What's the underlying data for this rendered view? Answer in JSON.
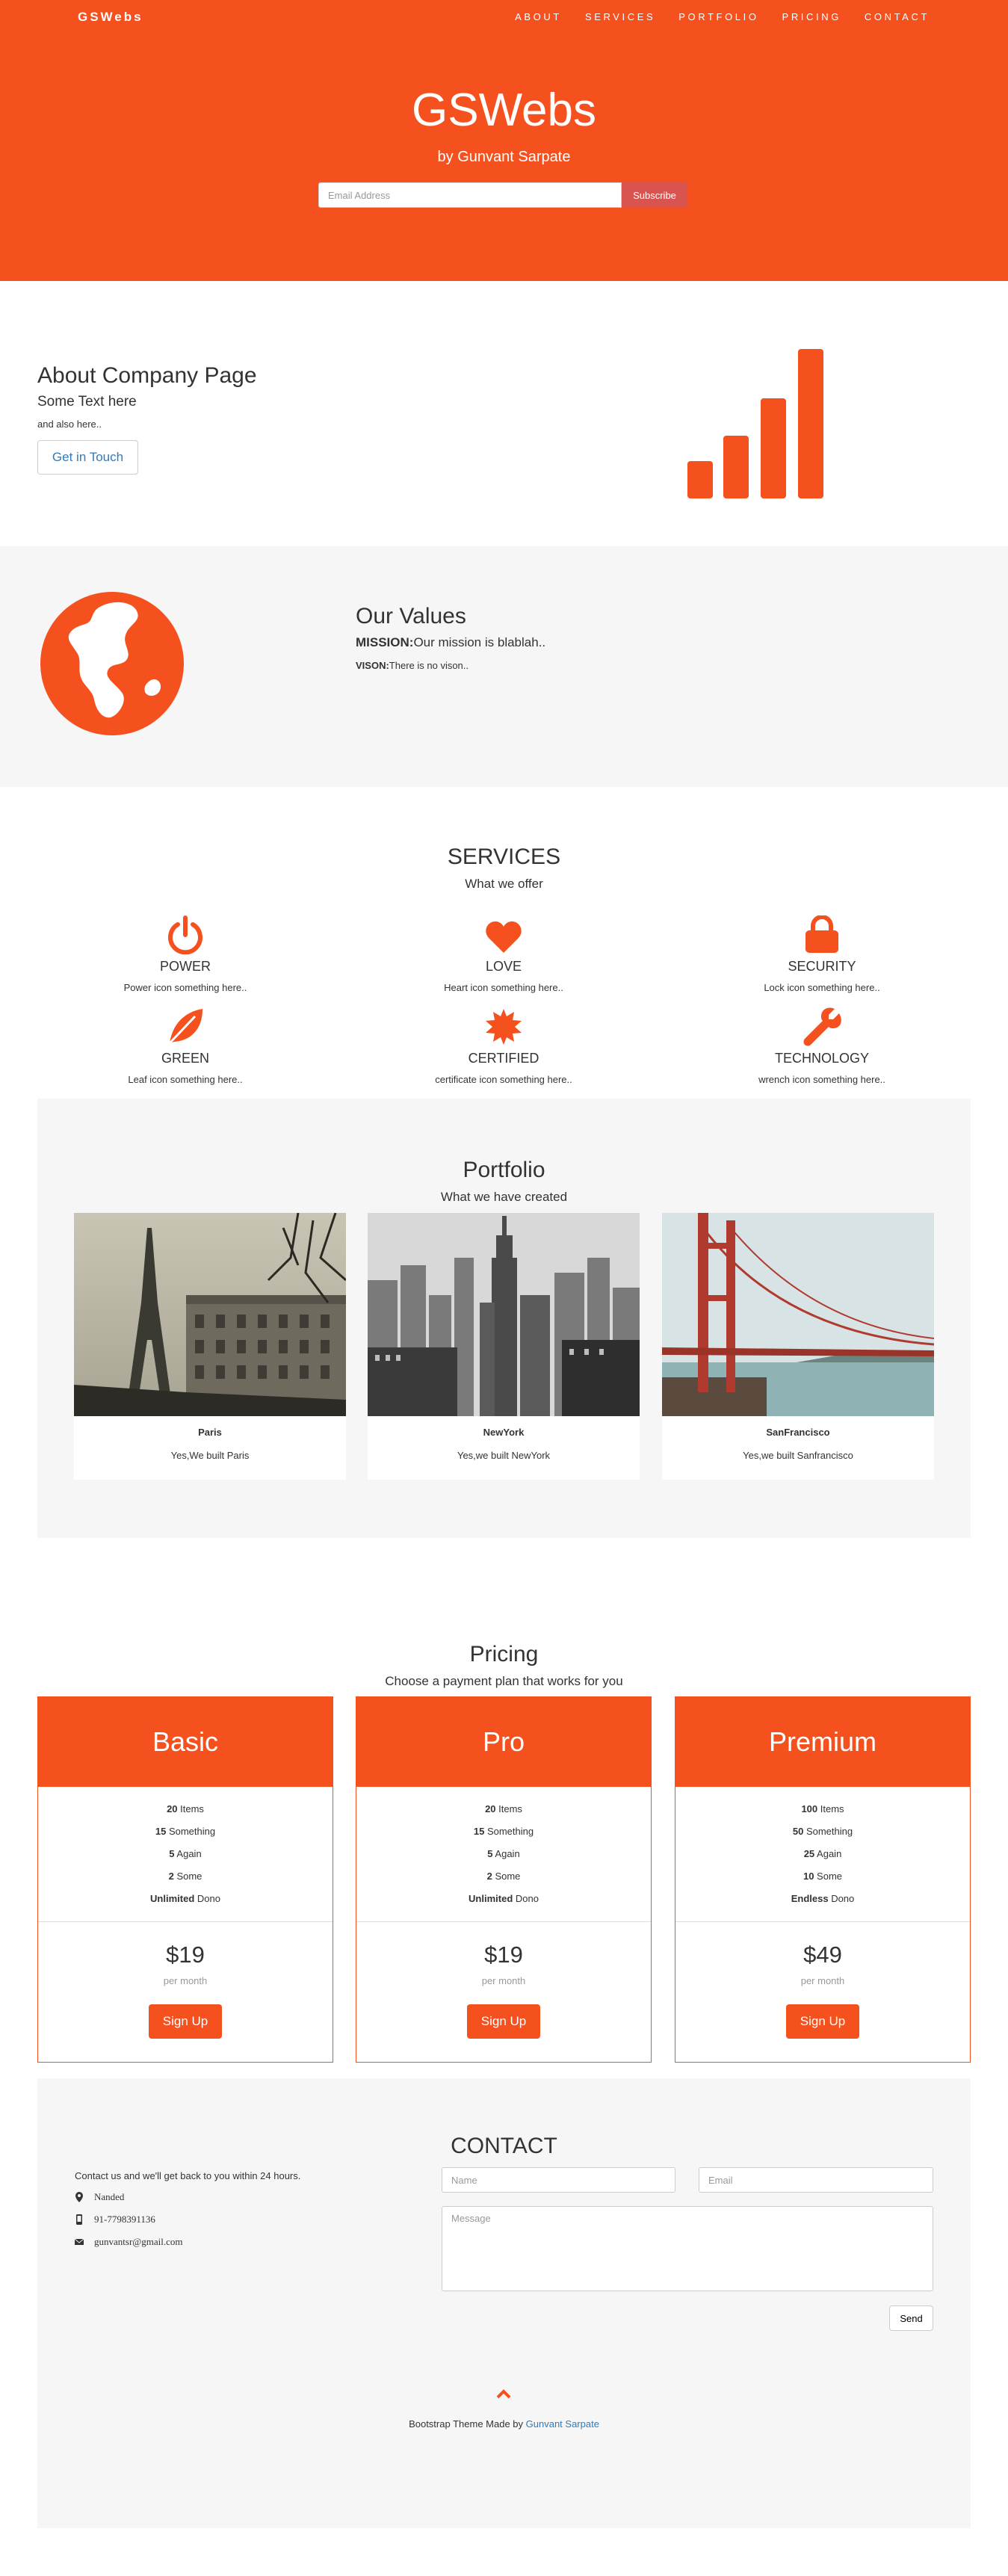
{
  "header": {
    "brand": "GSWebs",
    "nav": [
      "ABOUT",
      "SERVICES",
      "PORTFOLIO",
      "PRICING",
      "CONTACT"
    ],
    "title": "GSWebs",
    "subtitle": "by Gunvant Sarpate",
    "email_placeholder": "Email Address",
    "subscribe_label": "Subscribe"
  },
  "about": {
    "title": "About Company Page",
    "text": "Some Text here",
    "small": "and also here..",
    "button_label": "Get in Touch",
    "icon": "signal-icon"
  },
  "values": {
    "title": "Our Values",
    "mission_label": "MISSION:",
    "mission_text": "Our mission is blablah..",
    "vision_label": "VISON:",
    "vision_text": "There is no vison..",
    "icon": "globe-icon"
  },
  "services": {
    "title": "SERVICES",
    "subtitle": "What we offer",
    "items": [
      {
        "name": "POWER",
        "desc": "Power icon something here..",
        "icon": "power-icon"
      },
      {
        "name": "LOVE",
        "desc": "Heart icon something here..",
        "icon": "heart-icon"
      },
      {
        "name": "SECURITY",
        "desc": "Lock icon something here..",
        "icon": "lock-icon"
      },
      {
        "name": "GREEN",
        "desc": "Leaf icon something here..",
        "icon": "leaf-icon"
      },
      {
        "name": "CERTIFIED",
        "desc": "certificate icon something here..",
        "icon": "certificate-icon"
      },
      {
        "name": "TECHNOLOGY",
        "desc": "wrench icon something here..",
        "icon": "wrench-icon"
      }
    ]
  },
  "portfolio": {
    "title": "Portfolio",
    "subtitle": "What we have created",
    "items": [
      {
        "name": "Paris",
        "desc": "Yes,We built Paris"
      },
      {
        "name": "NewYork",
        "desc": "Yes,we built NewYork"
      },
      {
        "name": "SanFrancisco",
        "desc": "Yes,we built Sanfrancisco"
      }
    ]
  },
  "pricing": {
    "title": "Pricing",
    "subtitle": "Choose a payment plan that works for you",
    "plans": [
      {
        "name": "Basic",
        "features": [
          [
            "20",
            " Items"
          ],
          [
            "15",
            " Something"
          ],
          [
            "5",
            " Again"
          ],
          [
            "2",
            " Some"
          ],
          [
            "Unlimited",
            " Dono"
          ]
        ],
        "price": "$19",
        "period": "per month",
        "button": "Sign Up"
      },
      {
        "name": "Pro",
        "features": [
          [
            "20",
            " Items"
          ],
          [
            "15",
            " Something"
          ],
          [
            "5",
            " Again"
          ],
          [
            "2",
            " Some"
          ],
          [
            "Unlimited",
            " Dono"
          ]
        ],
        "price": "$19",
        "period": "per month",
        "button": "Sign Up"
      },
      {
        "name": "Premium",
        "features": [
          [
            "100",
            " Items"
          ],
          [
            "50",
            " Something"
          ],
          [
            "25",
            " Again"
          ],
          [
            "10",
            " Some"
          ],
          [
            "Endless",
            " Dono"
          ]
        ],
        "price": "$49",
        "period": "per month",
        "button": "Sign Up"
      }
    ]
  },
  "contact": {
    "title": "CONTACT",
    "intro": "Contact us and we'll get back to you within 24 hours.",
    "location": "Nanded",
    "phone": "91-7798391136",
    "email": "gunvantsr@gmail.com",
    "name_placeholder": "Name",
    "email_placeholder": "Email",
    "message_placeholder": "Message",
    "send_label": "Send"
  },
  "footer": {
    "text": "Bootstrap Theme Made by ",
    "link": "Gunvant Sarpate"
  },
  "colors": {
    "accent": "#f4511e",
    "section_bg": "#f6f6f6",
    "link": "#337ab7"
  }
}
